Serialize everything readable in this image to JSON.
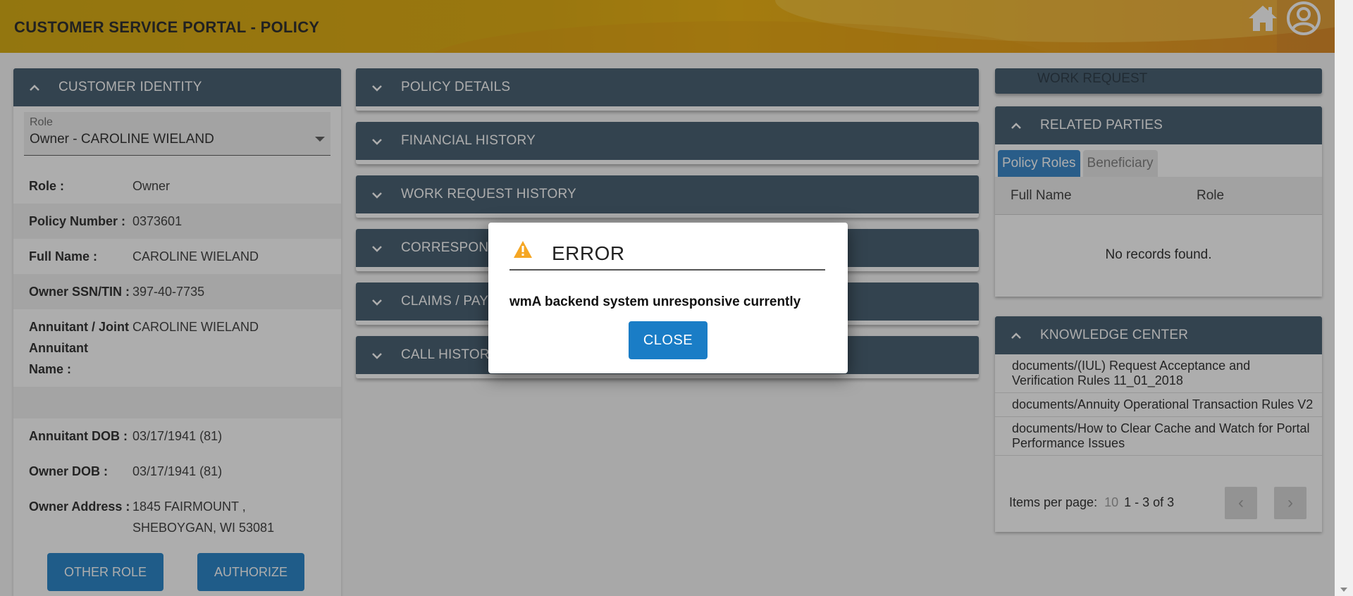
{
  "header": {
    "title": "CUSTOMER SERVICE PORTAL - POLICY",
    "home_icon": "home-icon",
    "user_icon": "user-icon"
  },
  "customer_identity": {
    "title": "CUSTOMER IDENTITY",
    "role_select": {
      "label": "Role",
      "value": "Owner - CAROLINE WIELAND"
    },
    "fields": [
      {
        "key": "Role",
        "value": "Owner"
      },
      {
        "key": "Policy Number",
        "value": "0373601"
      },
      {
        "key": "Full Name",
        "value": "CAROLINE WIELAND"
      },
      {
        "key": "Owner SSN/TIN",
        "value": "397-40-7735"
      },
      {
        "key": "Annuitant / Joint Annuitant Name",
        "value": "CAROLINE WIELAND"
      },
      {
        "key": "",
        "value": ""
      },
      {
        "key": "Annuitant DOB",
        "value": "03/17/1941 (81)"
      },
      {
        "key": "Owner DOB",
        "value": "03/17/1941 (81)"
      },
      {
        "key": "Owner Address",
        "value": "1845 FAIRMOUNT , SHEBOYGAN, WI 53081"
      }
    ],
    "buttons": {
      "other_role": "OTHER ROLE",
      "authorize": "AUTHORIZE"
    }
  },
  "middle_panels": [
    {
      "title": "POLICY DETAILS"
    },
    {
      "title": "FINANCIAL HISTORY"
    },
    {
      "title": "WORK REQUEST HISTORY"
    },
    {
      "title": "CORRESPONDENCE"
    },
    {
      "title": "CLAIMS / PAYOUTS"
    },
    {
      "title": "CALL HISTORY"
    }
  ],
  "work_request": {
    "title": "WORK REQUEST"
  },
  "related_parties": {
    "title": "RELATED PARTIES",
    "tabs": [
      "Policy Roles",
      "Beneficiary"
    ],
    "columns": [
      "Full Name",
      "Role"
    ],
    "empty_message": "No records found."
  },
  "knowledge_center": {
    "title": "KNOWLEDGE CENTER",
    "items": [
      "documents/(IUL) Request Acceptance and Verification Rules 11_01_2018",
      "documents/Annuity Operational Transaction Rules V2",
      "documents/How to Clear Cache and Watch for Portal Performance Issues"
    ],
    "items_per_page_label": "Items per page:",
    "items_per_page": "10",
    "range": "1 - 3 of 3"
  },
  "modal": {
    "title": "ERROR",
    "message": "wmA backend system unresponsive currently",
    "close_label": "CLOSE",
    "icon": "warning-icon"
  },
  "colors": {
    "panel_header": "#3b5468",
    "primary_button": "#1a7dc6",
    "header_gold": "#e0a800",
    "warning": "#f5a623"
  }
}
